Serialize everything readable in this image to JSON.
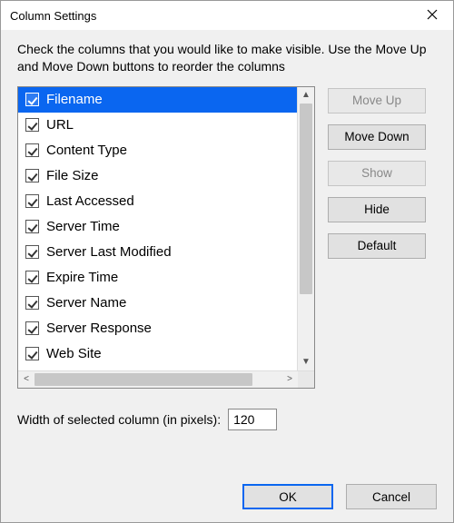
{
  "window": {
    "title": "Column Settings"
  },
  "instructions": "Check the columns that you would like to make visible. Use the Move Up and Move Down buttons to reorder the columns",
  "columns": [
    {
      "label": "Filename",
      "checked": true,
      "selected": true
    },
    {
      "label": "URL",
      "checked": true,
      "selected": false
    },
    {
      "label": "Content Type",
      "checked": true,
      "selected": false
    },
    {
      "label": "File Size",
      "checked": true,
      "selected": false
    },
    {
      "label": "Last Accessed",
      "checked": true,
      "selected": false
    },
    {
      "label": "Server Time",
      "checked": true,
      "selected": false
    },
    {
      "label": "Server Last Modified",
      "checked": true,
      "selected": false
    },
    {
      "label": "Expire Time",
      "checked": true,
      "selected": false
    },
    {
      "label": "Server Name",
      "checked": true,
      "selected": false
    },
    {
      "label": "Server Response",
      "checked": true,
      "selected": false
    },
    {
      "label": "Web Site",
      "checked": true,
      "selected": false
    }
  ],
  "side_buttons": {
    "move_up": {
      "label": "Move Up",
      "enabled": false
    },
    "move_down": {
      "label": "Move Down",
      "enabled": true
    },
    "show": {
      "label": "Show",
      "enabled": false
    },
    "hide": {
      "label": "Hide",
      "enabled": true
    },
    "default": {
      "label": "Default",
      "enabled": true
    }
  },
  "width_row": {
    "label": "Width of selected column (in pixels):",
    "value": "120"
  },
  "footer": {
    "ok": "OK",
    "cancel": "Cancel"
  }
}
